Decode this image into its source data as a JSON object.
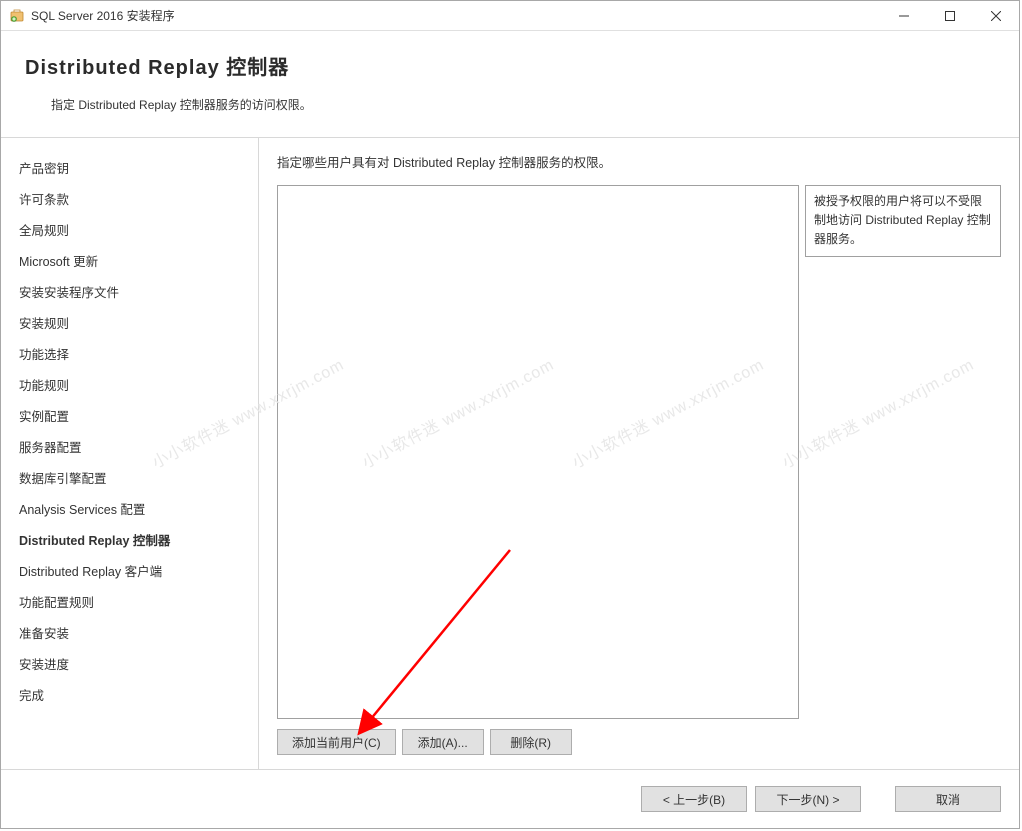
{
  "window": {
    "title": "SQL Server 2016 安装程序"
  },
  "header": {
    "title": "Distributed  Replay 控制器",
    "subtitle": "指定 Distributed Replay 控制器服务的访问权限。"
  },
  "sidebar": {
    "items": [
      {
        "label": "产品密钥"
      },
      {
        "label": "许可条款"
      },
      {
        "label": "全局规则"
      },
      {
        "label": "Microsoft 更新"
      },
      {
        "label": "安装安装程序文件"
      },
      {
        "label": "安装规则"
      },
      {
        "label": "功能选择"
      },
      {
        "label": "功能规则"
      },
      {
        "label": "实例配置"
      },
      {
        "label": "服务器配置"
      },
      {
        "label": "数据库引擎配置"
      },
      {
        "label": "Analysis Services 配置"
      },
      {
        "label": "Distributed Replay 控制器",
        "active": true
      },
      {
        "label": "Distributed Replay 客户端"
      },
      {
        "label": "功能配置规则"
      },
      {
        "label": "准备安装"
      },
      {
        "label": "安装进度"
      },
      {
        "label": "完成"
      }
    ]
  },
  "main": {
    "instruction": "指定哪些用户具有对 Distributed Replay 控制器服务的权限。",
    "info_box": "被授予权限的用户将可以不受限制地访问 Distributed Replay 控制器服务。",
    "buttons": {
      "add_current": "添加当前用户(C)",
      "add": "添加(A)...",
      "remove": "删除(R)"
    }
  },
  "footer": {
    "back": "< 上一步(B)",
    "next": "下一步(N) >",
    "cancel": "取消"
  },
  "watermark_text": "小小软件迷 www.xxrjm.com"
}
